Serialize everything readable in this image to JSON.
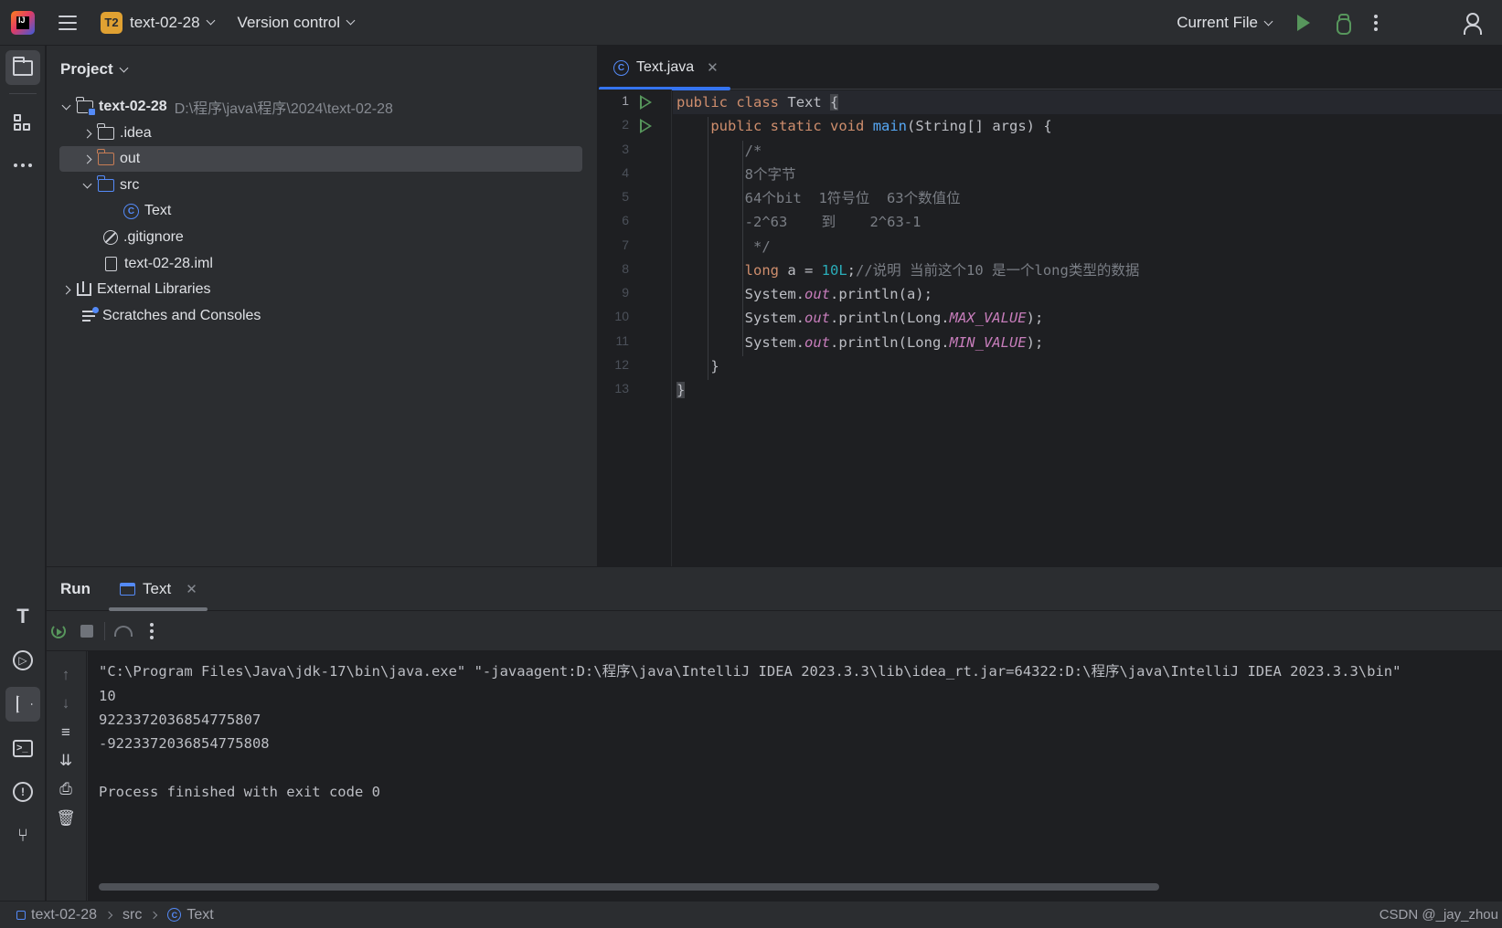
{
  "titlebar": {
    "project_badge": "T2",
    "project_name": "text-02-28",
    "vcs_menu": "Version control",
    "run_config": "Current File"
  },
  "leftstrip": {
    "icons": [
      "project-icon",
      "structure-icon",
      "more-icon",
      "build-icon",
      "services-icon",
      "run-icon",
      "terminal-icon",
      "problems-icon",
      "git-icon"
    ]
  },
  "project": {
    "title": "Project",
    "root_name": "text-02-28",
    "root_path": "D:\\程序\\java\\程序\\2024\\text-02-28",
    "items": [
      {
        "label": ".idea"
      },
      {
        "label": "out"
      },
      {
        "label": "src"
      },
      {
        "label": "Text"
      },
      {
        "label": ".gitignore"
      },
      {
        "label": "text-02-28.iml"
      },
      {
        "label": "External Libraries"
      },
      {
        "label": "Scratches and Consoles"
      }
    ]
  },
  "editor": {
    "tab_label": "Text.java",
    "line_numbers": [
      "1",
      "2",
      "3",
      "4",
      "5",
      "6",
      "7",
      "8",
      "9",
      "10",
      "11",
      "12",
      "13"
    ],
    "code": {
      "l1": {
        "kw1": "public",
        "kw2": "class",
        "name": "Text",
        "brace": "{"
      },
      "l2": {
        "kw1": "public",
        "kw2": "static",
        "kw3": "void",
        "fn": "main",
        "rest": "(String[] args) {"
      },
      "l3": "/*",
      "l4": "8个字节",
      "l5": "64个bit  1符号位  63个数值位",
      "l6": "-2^63    到    2^63-1",
      "l7": " */",
      "l8": {
        "kw": "long",
        "mid": " a = ",
        "num": "10L",
        "semi": ";",
        "comment": "//说明 当前这个10 是一个long类型的数据"
      },
      "l9": {
        "a": "System.",
        "field": "out",
        "b": ".println(a);"
      },
      "l10": {
        "a": "System.",
        "field": "out",
        "b": ".println(Long.",
        "const": "MAX_VALUE",
        "c": ");"
      },
      "l11": {
        "a": "System.",
        "field": "out",
        "b": ".println(Long.",
        "const": "MIN_VALUE",
        "c": ");"
      },
      "l12": "}",
      "l13": "}"
    }
  },
  "run": {
    "title": "Run",
    "tab_label": "Text",
    "console": [
      "\"C:\\Program Files\\Java\\jdk-17\\bin\\java.exe\" \"-javaagent:D:\\程序\\java\\IntelliJ IDEA 2023.3.3\\lib\\idea_rt.jar=64322:D:\\程序\\java\\IntelliJ IDEA 2023.3.3\\bin\"",
      "10",
      "9223372036854775807",
      "-9223372036854775808",
      "",
      "Process finished with exit code 0"
    ]
  },
  "statusbar": {
    "crumb1": "text-02-28",
    "crumb2": "src",
    "crumb3": "Text",
    "right_text": "CSDN @_jay_zhou"
  }
}
